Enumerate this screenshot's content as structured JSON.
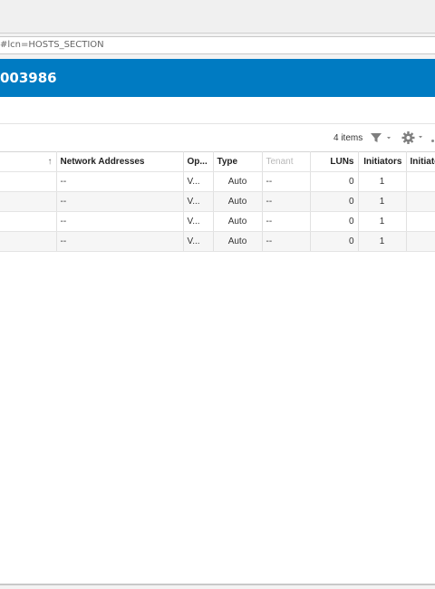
{
  "browser": {
    "url": "#lcn=HOSTS_SECTION"
  },
  "header": {
    "title": "003986"
  },
  "toolbar": {
    "items_count": "4 items",
    "filter_icon": "filter-icon",
    "settings_icon": "gear-icon"
  },
  "table": {
    "columns": [
      "Network Addresses",
      "Op...",
      "Type",
      "Tenant",
      "LUNs",
      "Initiators",
      "Initiato"
    ],
    "rows": [
      {
        "network_addresses": "--",
        "op": "V...",
        "type": "Auto",
        "tenant": "--",
        "luns": "0",
        "initiators": "1",
        "initiato": ""
      },
      {
        "network_addresses": "--",
        "op": "V...",
        "type": "Auto",
        "tenant": "--",
        "luns": "0",
        "initiators": "1",
        "initiato": ""
      },
      {
        "network_addresses": "--",
        "op": "V...",
        "type": "Auto",
        "tenant": "--",
        "luns": "0",
        "initiators": "1",
        "initiato": ""
      },
      {
        "network_addresses": "--",
        "op": "V...",
        "type": "Auto",
        "tenant": "--",
        "luns": "0",
        "initiators": "1",
        "initiato": ""
      }
    ]
  },
  "colors": {
    "header_band": "#007bc2",
    "link": "#0a79c2"
  }
}
